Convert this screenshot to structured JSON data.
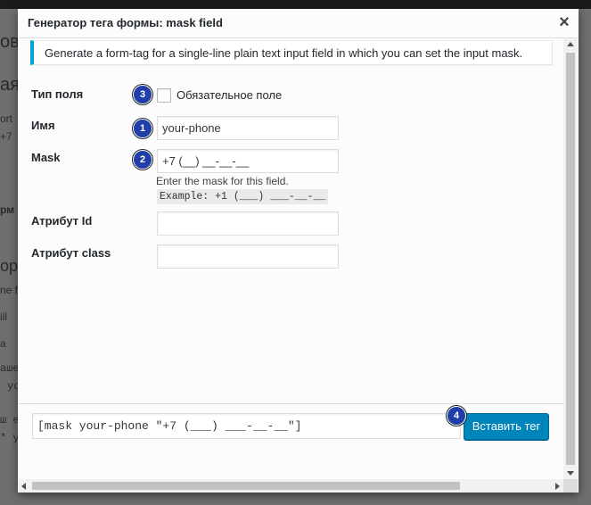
{
  "dialog": {
    "title": "Генератор тега формы: mask field",
    "close_glyph": "×",
    "description": "Generate a form-tag for a single-line plain text input field in which you can set the input mask."
  },
  "fields": {
    "type": {
      "label": "Тип поля",
      "checkbox_label": "Обязательное поле",
      "checked": false
    },
    "name": {
      "label": "Имя",
      "value": "your-phone"
    },
    "mask": {
      "label": "Mask",
      "value": "+7 (__) __-__-__",
      "hint": "Enter the mask for this field.",
      "example": "Example: +1 (___) ___-__-__"
    },
    "id": {
      "label": "Атрибут Id",
      "value": ""
    },
    "class": {
      "label": "Атрибут class",
      "value": ""
    }
  },
  "footer": {
    "tag": "[mask your-phone \"+7 (___) ___-__-__\"]",
    "insert_label": "Вставить тег"
  },
  "badges": {
    "b1": "1",
    "b2": "2",
    "b3": "3",
    "b4": "4"
  },
  "background": {
    "f1": "ов",
    "f2": "ая",
    "f3": "ort",
    "f4": "+7",
    "f5": "рм",
    "f6": "ор",
    "f7": "ne fi",
    "f8": "ill",
    "f9": "а",
    "f10": "аше",
    "f11": "ус",
    "f12": "ш е",
    "f13": "* у"
  },
  "colors": {
    "accent": "#0085ba",
    "notice_border": "#00a0d2",
    "badge": "#1f3ea8"
  },
  "icons": {
    "close": "close-icon",
    "checkbox": "checkbox-icon"
  }
}
